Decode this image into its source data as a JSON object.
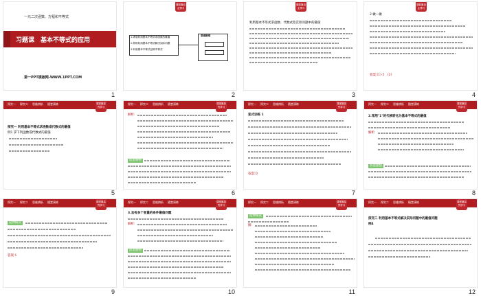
{
  "slides": [
    {
      "num": "1",
      "title": "习题课　基本不等式的应用",
      "subtitle": "一元二次函数、方程和不等式",
      "footer": "第一PPT模板网-WWW.1PPT.COM"
    },
    {
      "num": "2",
      "badge": "课前篇自主预习",
      "box_title": "思维脉络",
      "box_lines": [
        "1.体验利用基本不等式求函数的最值",
        "2.熟练利用基本不等式解决实际问题",
        "3.利用基本不等式证明不等式"
      ]
    },
    {
      "num": "3",
      "badge": "课前篇自主预习",
      "text": "利用基本不等式求函数、代数式及实际问题中的最值"
    },
    {
      "num": "4",
      "badge": "课前篇自主预习",
      "text": "2.做一做",
      "answer": "答案:(1)-5　(2)"
    },
    {
      "num": "5",
      "tabs": [
        "探究一",
        "探究二",
        "思维辨析",
        "随堂演练"
      ],
      "badge": "课堂篇探究学习",
      "heading": "探究一 利用基本不等式求函数或代数式的最值",
      "text": "例1 求下列函数或代数式的最值"
    },
    {
      "num": "6",
      "tabs": [
        "探究一",
        "探究二",
        "思维辨析",
        "随堂演练"
      ],
      "badge": "课堂篇探究学习",
      "label": "解析:",
      "label2": "反思感悟"
    },
    {
      "num": "7",
      "tabs": [
        "探究一",
        "探究二",
        "思维辨析",
        "随堂演练"
      ],
      "badge": "课堂篇探究学习",
      "heading": "变式训练 1",
      "answer": "答案:D"
    },
    {
      "num": "8",
      "tabs": [
        "探究一",
        "探究二",
        "思维辨析",
        "随堂演练"
      ],
      "badge": "课堂篇探究学习",
      "heading": "2.常用\"1\"的代换转化为基本不等式的最值",
      "label": "解析:",
      "label2": "反思感悟"
    },
    {
      "num": "9",
      "tabs": [
        "探究一",
        "探究二",
        "思维辨析",
        "随堂演练"
      ],
      "badge": "课堂篇探究学习",
      "heading": "延伸探究",
      "answer": "答案:1"
    },
    {
      "num": "10",
      "tabs": [
        "探究一",
        "探究二",
        "思维辨析",
        "随堂演练"
      ],
      "badge": "课堂篇探究学习",
      "heading": "3.含有多个变量的条件最值问题",
      "label": "解析:",
      "label2": "反思感悟"
    },
    {
      "num": "11",
      "tabs": [
        "探究一",
        "探究二",
        "思维辨析",
        "随堂演练"
      ],
      "badge": "课堂篇探究学习",
      "heading": "延伸探究",
      "label": "解:"
    },
    {
      "num": "12",
      "tabs": [
        "探究一",
        "探究二",
        "思维辨析",
        "随堂演练"
      ],
      "badge": "课堂篇探究学习",
      "heading": "探究二 利用基本不等式解决实际问题中的最值问题",
      "text": "例4"
    }
  ]
}
